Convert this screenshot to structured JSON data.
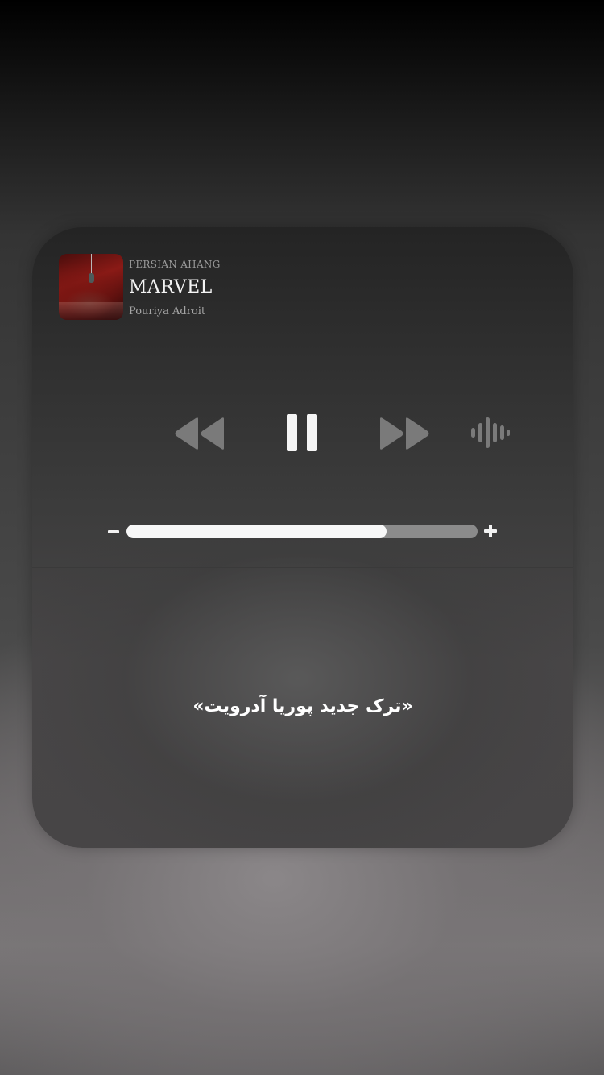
{
  "player": {
    "source_label": "PERSIAN AHANG",
    "track_title": "MARVEL",
    "artist": "Pouriya Adroit",
    "is_playing": true,
    "volume_fraction": 0.74
  },
  "controls": {
    "rewind_icon": "rewind-icon",
    "pause_icon": "pause-icon",
    "forward_icon": "fast-forward-icon",
    "audio_icon": "audio-waveform-icon"
  },
  "volume": {
    "minus_icon": "minus-icon",
    "plus_icon": "plus-icon"
  },
  "caption": "«ترک جدید پوریا آدرویت»",
  "colors": {
    "control_grey": "#7a7a7a",
    "pause_white": "#f5f5f5",
    "volume_fill": "#f7f7f7",
    "volume_track": "#8b8b8b"
  }
}
